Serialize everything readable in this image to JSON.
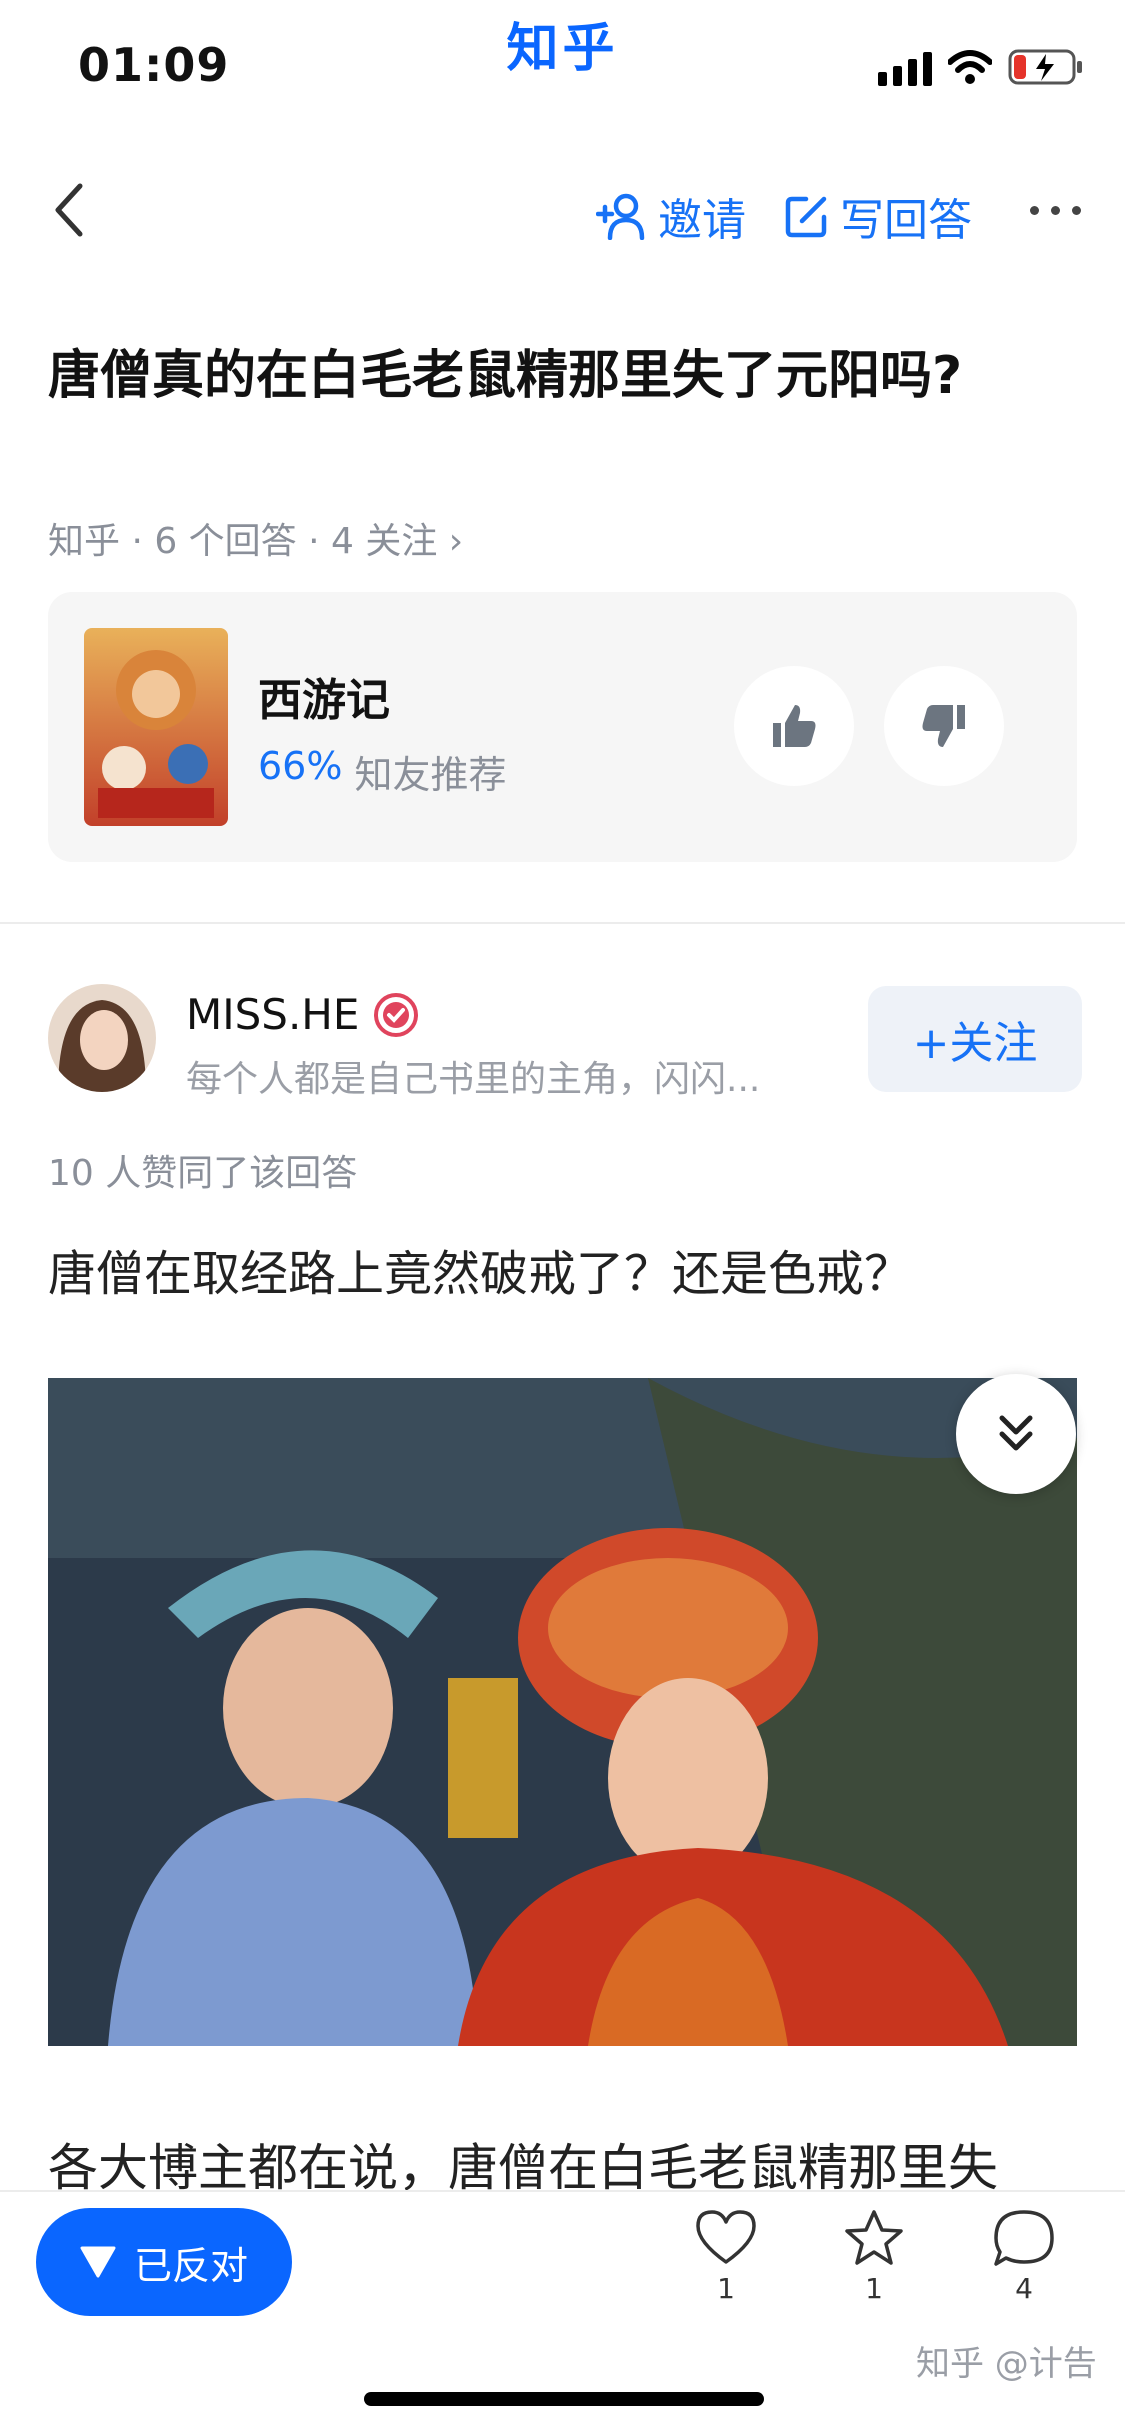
{
  "status_bar": {
    "time": "01:09",
    "brand": "知乎"
  },
  "nav": {
    "invite": "邀请",
    "write_answer": "写回答"
  },
  "question": {
    "title": "唐僧真的在白毛老鼠精那里失了元阳吗?",
    "meta": "知乎 · 6 个回答 · 4 关注 ›"
  },
  "media_card": {
    "name": "西游记",
    "percent": "66%",
    "recommend": "知友推荐"
  },
  "answer": {
    "author": "MISS.HE",
    "bio": "每个人都是自己书里的主角，闪闪...",
    "follow": "+关注",
    "voters": "10 人赞同了该回答",
    "paragraph1": "唐僧在取经路上竟然破戒了？还是色戒？",
    "paragraph2": "各大博主都在说，唐僧在白毛老鼠精那里失"
  },
  "bottom_bar": {
    "oppose": "已反对",
    "like_count": "1",
    "favorite_count": "1",
    "comment_count": "4"
  },
  "watermark": "知乎 @计告",
  "colors": {
    "brand": "#0a66ff",
    "link": "#1772f6"
  }
}
